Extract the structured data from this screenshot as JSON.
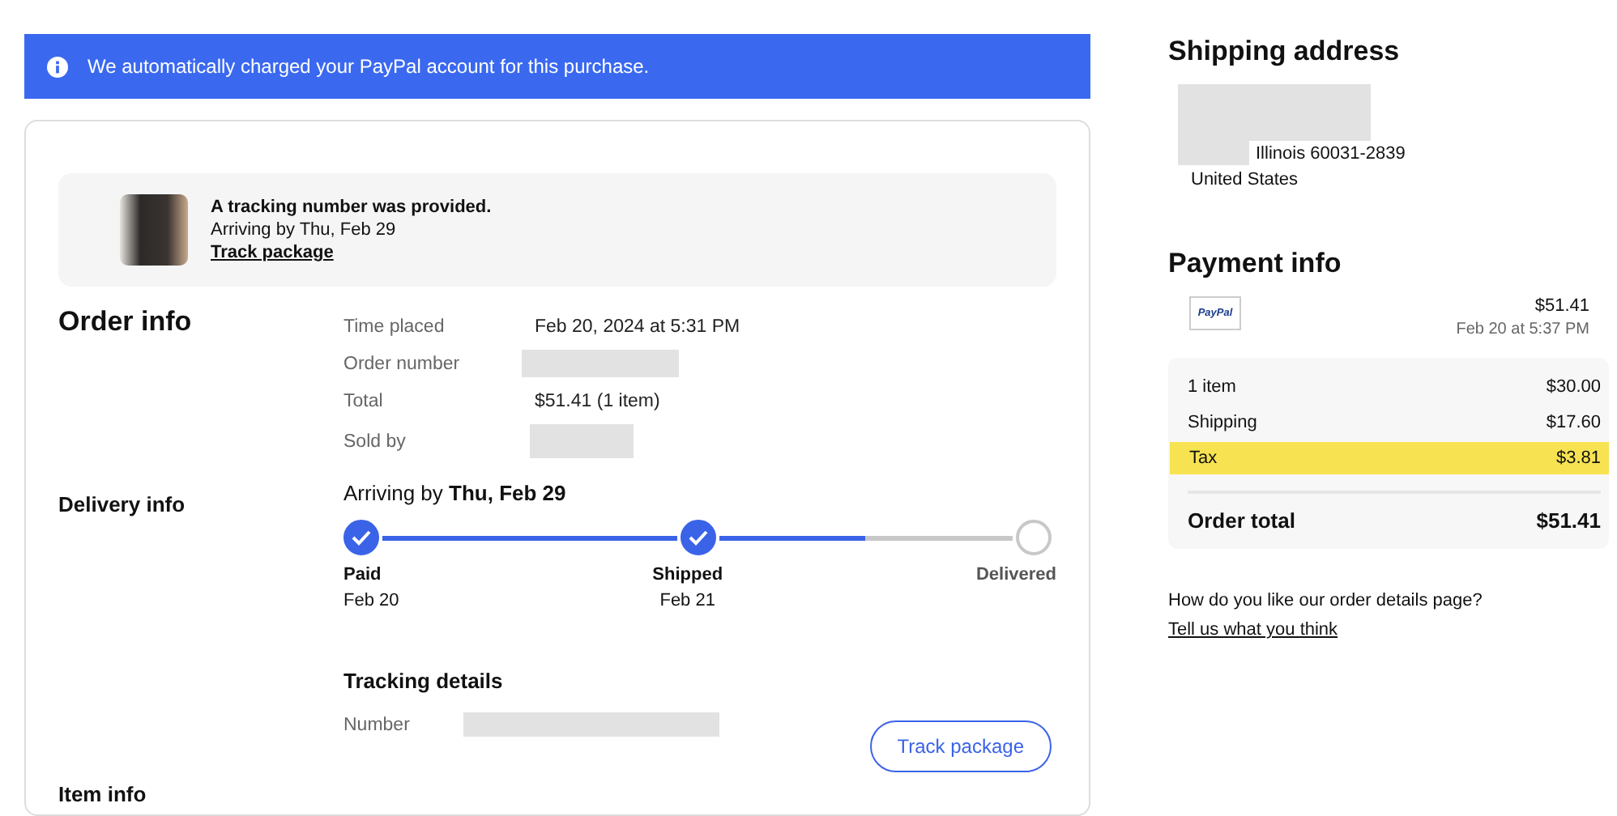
{
  "banner": {
    "text": "We automatically charged your PayPal account for this purchase."
  },
  "notice": {
    "title": "A tracking number was provided.",
    "subtitle": "Arriving by Thu, Feb 29",
    "link": "Track package"
  },
  "order_info": {
    "heading": "Order info",
    "rows": [
      {
        "label": "Time placed",
        "value": "Feb 20, 2024 at 5:31 PM"
      },
      {
        "label": "Order number",
        "value": null
      },
      {
        "label": "Total",
        "value": "$51.41 (1 item)"
      },
      {
        "label": "Sold by",
        "value": null
      }
    ]
  },
  "delivery_info": {
    "heading": "Delivery info",
    "arriving": "Arriving by **Thu, Feb 29**",
    "connectors": [
      {
        "level": 1
      },
      {
        "level": 0.5
      }
    ],
    "steps": [
      {
        "label": "Paid",
        "date": "Feb 20",
        "done": true
      },
      {
        "label": "Shipped",
        "date": "Feb 21",
        "done": true
      },
      {
        "label": "Delivered",
        "done": false
      }
    ],
    "tracking_heading": "Tracking details",
    "number_label": "Number",
    "button": "Track package"
  },
  "item_info": {
    "heading": "Item info"
  },
  "shipping_address": {
    "heading": "Shipping address",
    "line": "Illinois 60031-2839",
    "country": "United States"
  },
  "payment_info": {
    "heading": "Payment info",
    "method": "PayPal",
    "amount": "$51.41",
    "date": "Feb 20 at 5:37 PM",
    "rows": [
      {
        "label": "1 item",
        "value": "$30.00",
        "highlighted": false
      },
      {
        "label": "Shipping",
        "value": "$17.60",
        "highlighted": false
      },
      {
        "label": "Tax",
        "value": "$3.81",
        "highlighted": true
      }
    ],
    "total_label": "Order total",
    "total_value": "$51.41"
  },
  "feedback": {
    "question": "How do you like our order details page?",
    "link": "Tell us what you think"
  }
}
